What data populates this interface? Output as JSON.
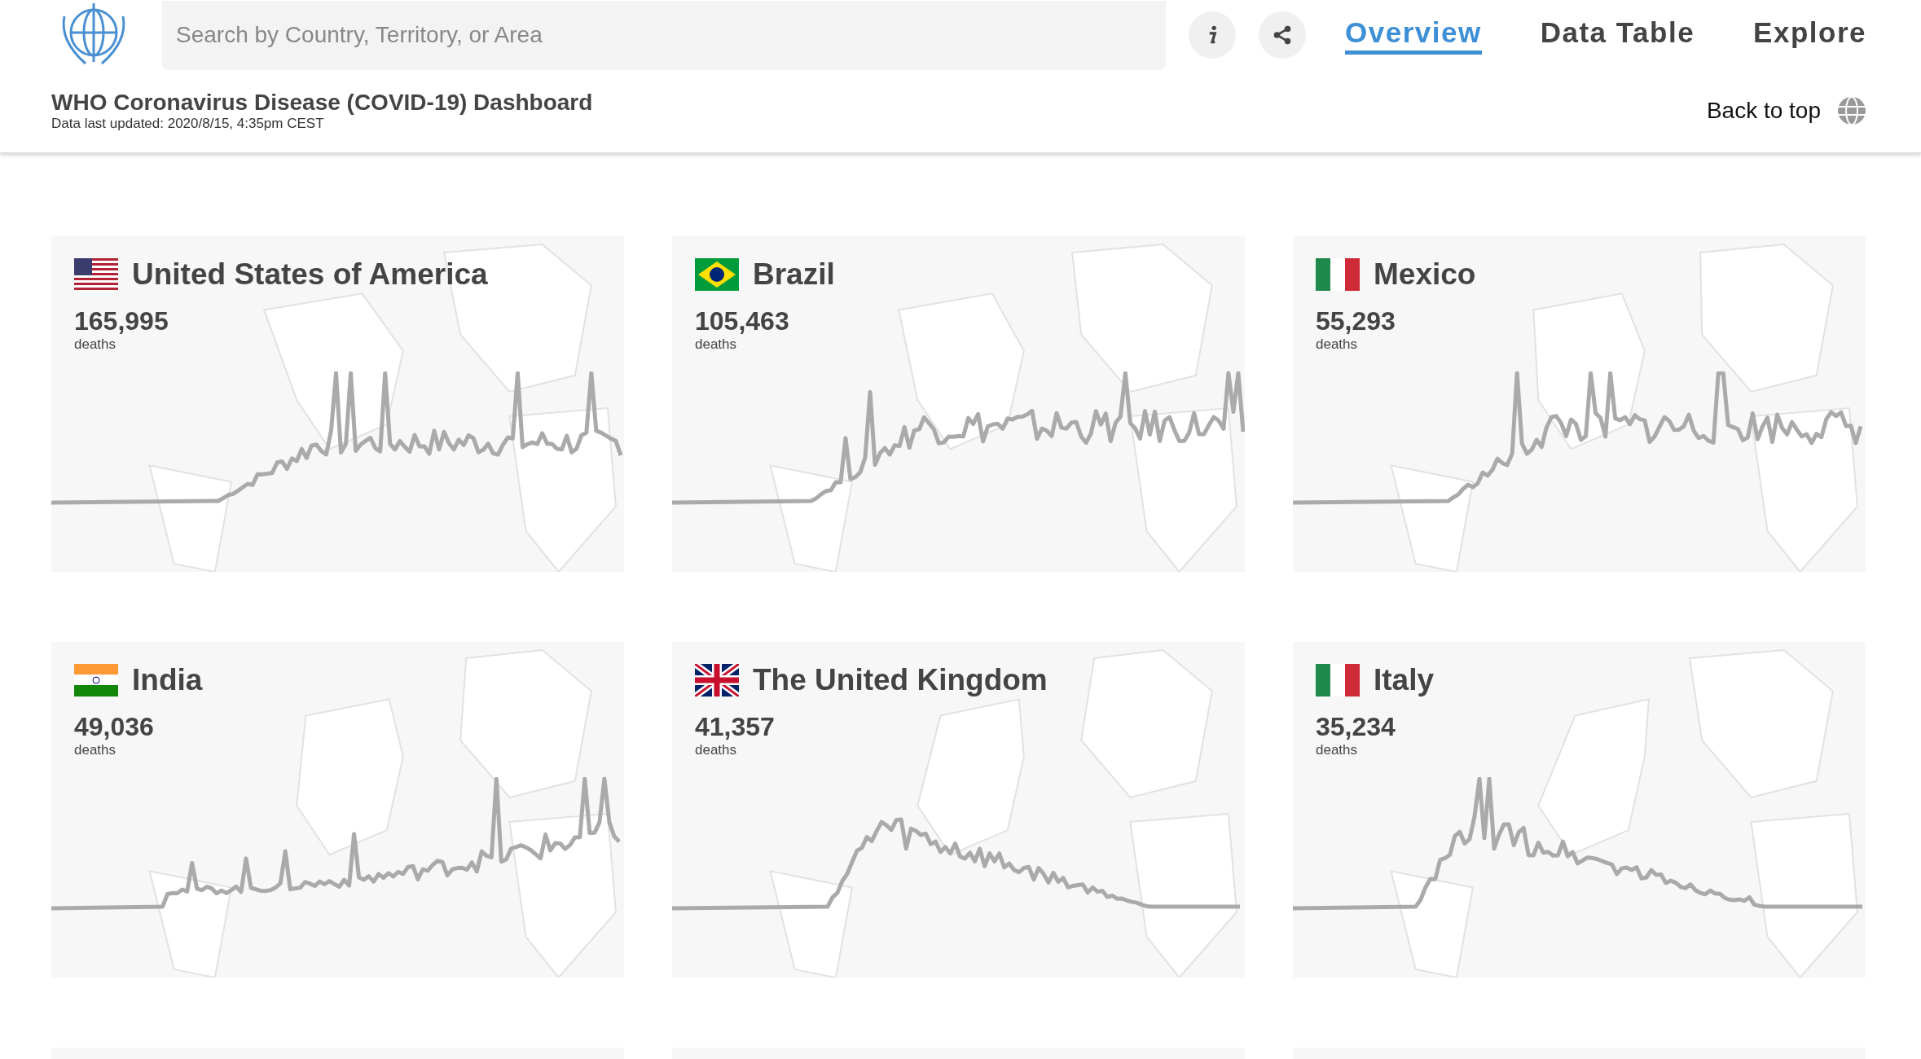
{
  "header": {
    "search": {
      "placeholder": "Search by Country, Territory, or Area"
    },
    "tabs": [
      {
        "label": "Overview",
        "selected": true
      },
      {
        "label": "Data Table",
        "selected": false
      },
      {
        "label": "Explore",
        "selected": false
      }
    ],
    "title": "WHO Coronavirus Disease (COVID-19) Dashboard",
    "updated": "Data last updated: 2020/8/15, 4:35pm CEST",
    "back_to_top": "Back to top"
  },
  "cards": [
    {
      "country": "United States of America",
      "deaths": "165,995",
      "unit": "deaths",
      "flag": {
        "kind": "stars-stripes"
      }
    },
    {
      "country": "Brazil",
      "deaths": "105,463",
      "unit": "deaths",
      "flag": {
        "kind": "diamond"
      }
    },
    {
      "country": "Mexico",
      "deaths": "55,293",
      "unit": "deaths",
      "flag": {
        "kind": "vertical-tricolor"
      }
    },
    {
      "country": "India",
      "deaths": "49,036",
      "unit": "deaths",
      "flag": {
        "kind": "horizontal-tricolor"
      }
    },
    {
      "country": "The United Kingdom",
      "deaths": "41,357",
      "unit": "deaths",
      "flag": {
        "kind": "union"
      }
    },
    {
      "country": "Italy",
      "deaths": "35,234",
      "unit": "deaths",
      "flag": {
        "kind": "vertical-tricolor"
      }
    }
  ]
}
